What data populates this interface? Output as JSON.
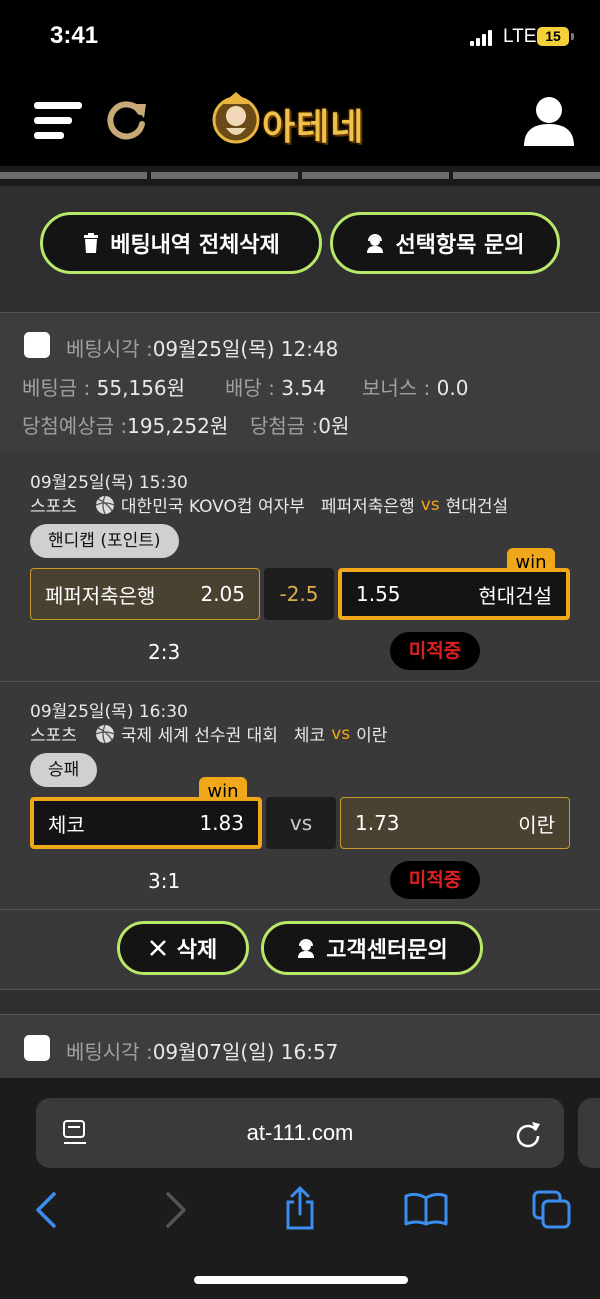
{
  "status": {
    "time": "3:41",
    "network": "LTE",
    "battery": "15"
  },
  "header": {
    "logo_text": "아테네"
  },
  "actions": {
    "delete_all": "베팅내역 전체삭제",
    "inquire_selected": "선택항목 문의"
  },
  "bets": [
    {
      "bet_time_label": "베팅시각 :",
      "bet_time": "09월25일(목) 12:48",
      "stake_label": "베팅금 :",
      "stake": "55,156원",
      "odds_label": "배당 :",
      "odds": "3.54",
      "bonus_label": "보너스 :",
      "bonus": "0.0",
      "expected_label": "당첨예상금 :",
      "expected": "195,252원",
      "payout_label": "당첨금 :",
      "payout": "0원",
      "games": [
        {
          "datetime": "09월25일(목) 15:30",
          "sport": "스포츠",
          "league": "대한민국 KOVO컵 여자부",
          "home": "페퍼저축은행",
          "vs": "vs",
          "away": "현대건설",
          "market": "핸디캡 (포인트)",
          "home_odds": "2.05",
          "middle": "-2.5",
          "away_odds": "1.55",
          "win_label": "win",
          "score": "2:3",
          "result": "미적중"
        },
        {
          "datetime": "09월25일(목) 16:30",
          "sport": "스포츠",
          "league": "국제 세계 선수권 대회",
          "home": "체코",
          "vs": "vs",
          "away": "이란",
          "market": "승패",
          "home_odds": "1.83",
          "middle": "vs",
          "away_odds": "1.73",
          "win_label": "win",
          "score": "3:1",
          "result": "미적중"
        }
      ],
      "delete_label": "삭제",
      "support_label": "고객센터문의"
    },
    {
      "bet_time_label": "베팅시각 :",
      "bet_time": "09월07일(일) 16:57"
    }
  ],
  "browser": {
    "url": "at-111.com"
  },
  "colors": {
    "accent_green": "#b8e86a",
    "accent_orange": "#f0a81a",
    "miss_red": "#e02020"
  }
}
